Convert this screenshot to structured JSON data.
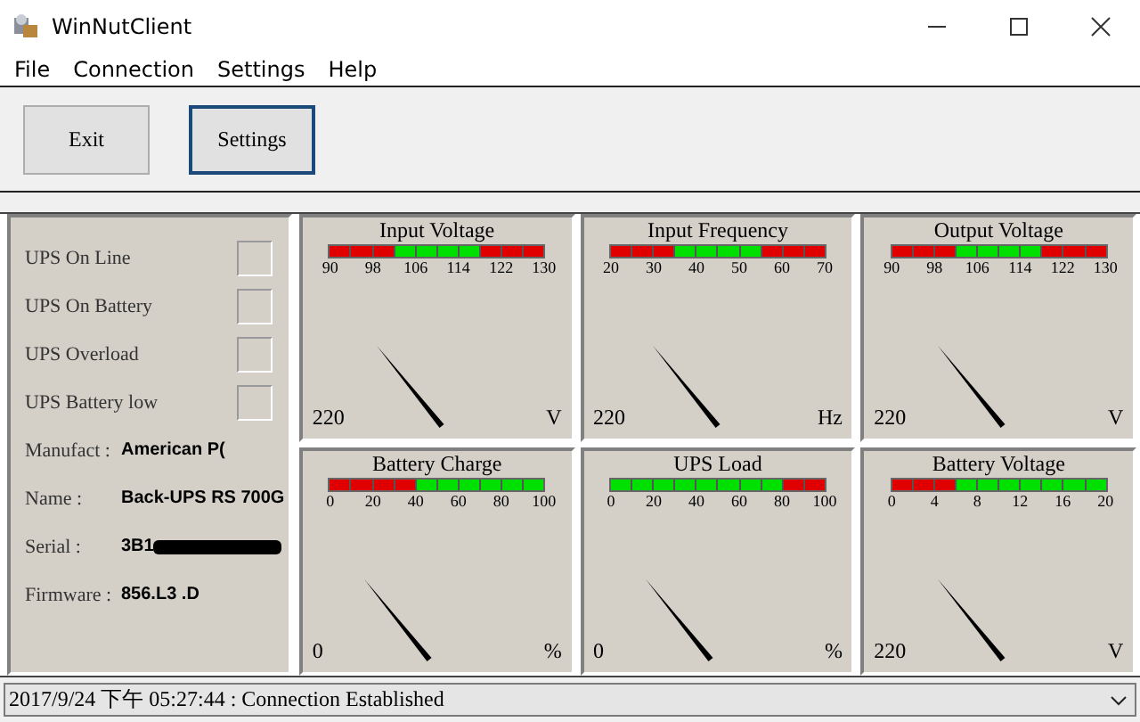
{
  "window": {
    "title": "WinNutClient"
  },
  "menu": [
    "File",
    "Connection",
    "Settings",
    "Help"
  ],
  "toolbar": [
    {
      "label": "Exit",
      "selected": false
    },
    {
      "label": "Settings",
      "selected": true
    }
  ],
  "indicators": [
    {
      "label": "UPS On Line",
      "on": false
    },
    {
      "label": "UPS On Battery",
      "on": false
    },
    {
      "label": "UPS Overload",
      "on": false
    },
    {
      "label": "UPS Battery low",
      "on": false
    }
  ],
  "info": [
    {
      "label": "Manufact :",
      "value": "American P("
    },
    {
      "label": "Name :",
      "value": "Back-UPS RS 700G"
    },
    {
      "label": "Serial :",
      "value": "3B1",
      "redacted": true
    },
    {
      "label": "Firmware :",
      "value": "856.L3 .D"
    }
  ],
  "gauges": [
    {
      "title": "Input Voltage",
      "ticks": [
        "90",
        "98",
        "106",
        "114",
        "122",
        "130"
      ],
      "segments": [
        {
          "color": "#e00000"
        },
        {
          "color": "#e00000"
        },
        {
          "color": "#e00000"
        },
        {
          "color": "#00e000"
        },
        {
          "color": "#00e000"
        },
        {
          "color": "#00e000"
        },
        {
          "color": "#00e000"
        },
        {
          "color": "#e00000"
        },
        {
          "color": "#e00000"
        },
        {
          "color": "#e00000"
        }
      ],
      "value": "220",
      "unit": "V"
    },
    {
      "title": "Input Frequency",
      "ticks": [
        "20",
        "30",
        "40",
        "50",
        "60",
        "70"
      ],
      "segments": [
        {
          "color": "#e00000"
        },
        {
          "color": "#e00000"
        },
        {
          "color": "#e00000"
        },
        {
          "color": "#00e000"
        },
        {
          "color": "#00e000"
        },
        {
          "color": "#00e000"
        },
        {
          "color": "#00e000"
        },
        {
          "color": "#e00000"
        },
        {
          "color": "#e00000"
        },
        {
          "color": "#e00000"
        }
      ],
      "value": "220",
      "unit": "Hz"
    },
    {
      "title": "Output Voltage",
      "ticks": [
        "90",
        "98",
        "106",
        "114",
        "122",
        "130"
      ],
      "segments": [
        {
          "color": "#e00000"
        },
        {
          "color": "#e00000"
        },
        {
          "color": "#e00000"
        },
        {
          "color": "#00e000"
        },
        {
          "color": "#00e000"
        },
        {
          "color": "#00e000"
        },
        {
          "color": "#00e000"
        },
        {
          "color": "#e00000"
        },
        {
          "color": "#e00000"
        },
        {
          "color": "#e00000"
        }
      ],
      "value": "220",
      "unit": "V"
    },
    {
      "title": "Battery Charge",
      "ticks": [
        "0",
        "20",
        "40",
        "60",
        "80",
        "100"
      ],
      "segments": [
        {
          "color": "#e00000"
        },
        {
          "color": "#e00000"
        },
        {
          "color": "#e00000"
        },
        {
          "color": "#e00000"
        },
        {
          "color": "#00e000"
        },
        {
          "color": "#00e000"
        },
        {
          "color": "#00e000"
        },
        {
          "color": "#00e000"
        },
        {
          "color": "#00e000"
        },
        {
          "color": "#00e000"
        }
      ],
      "value": "0",
      "unit": "%"
    },
    {
      "title": "UPS Load",
      "ticks": [
        "0",
        "20",
        "40",
        "60",
        "80",
        "100"
      ],
      "segments": [
        {
          "color": "#00e000"
        },
        {
          "color": "#00e000"
        },
        {
          "color": "#00e000"
        },
        {
          "color": "#00e000"
        },
        {
          "color": "#00e000"
        },
        {
          "color": "#00e000"
        },
        {
          "color": "#00e000"
        },
        {
          "color": "#00e000"
        },
        {
          "color": "#e00000"
        },
        {
          "color": "#e00000"
        }
      ],
      "value": "0",
      "unit": "%"
    },
    {
      "title": "Battery Voltage",
      "ticks": [
        "0",
        "4",
        "8",
        "12",
        "16",
        "20"
      ],
      "segments": [
        {
          "color": "#e00000"
        },
        {
          "color": "#e00000"
        },
        {
          "color": "#e00000"
        },
        {
          "color": "#00e000"
        },
        {
          "color": "#00e000"
        },
        {
          "color": "#00e000"
        },
        {
          "color": "#00e000"
        },
        {
          "color": "#00e000"
        },
        {
          "color": "#00e000"
        },
        {
          "color": "#00e000"
        }
      ],
      "value": "220",
      "unit": "V"
    }
  ],
  "status_bar": {
    "text": "2017/9/24 下午 05:27:44 : Connection Established"
  }
}
